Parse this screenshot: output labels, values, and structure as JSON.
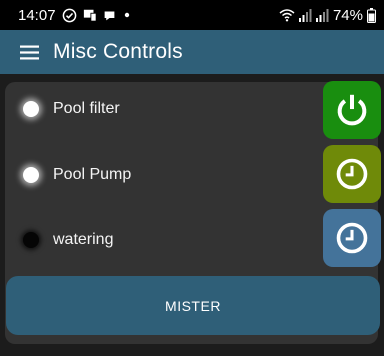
{
  "status_bar": {
    "time": "14:07",
    "battery": "74%",
    "icons": [
      "do-not-disturb-icon",
      "screen-cast-icon",
      "chat-bubble-icon",
      "dot-icon",
      "wifi-icon",
      "signal-icon",
      "signal-icon",
      "battery-icon"
    ]
  },
  "app_bar": {
    "menu_icon": "hamburger-menu-icon",
    "title": "Misc Controls"
  },
  "controls": [
    {
      "label": "Pool filter",
      "indicator": "on",
      "button_icon": "power-icon",
      "button_color": "#198e0f"
    },
    {
      "label": "Pool Pump",
      "indicator": "on",
      "button_icon": "clock-icon",
      "button_color": "#6f8a09"
    },
    {
      "label": "watering",
      "indicator": "off",
      "button_icon": "clock-icon",
      "button_color": "#44739a"
    }
  ],
  "mister_button": {
    "label": "MISTER",
    "color": "#2f5f78"
  },
  "colors": {
    "app_bar": "#2f5f78",
    "panel": "#333333",
    "background": "#1c1c1c"
  }
}
